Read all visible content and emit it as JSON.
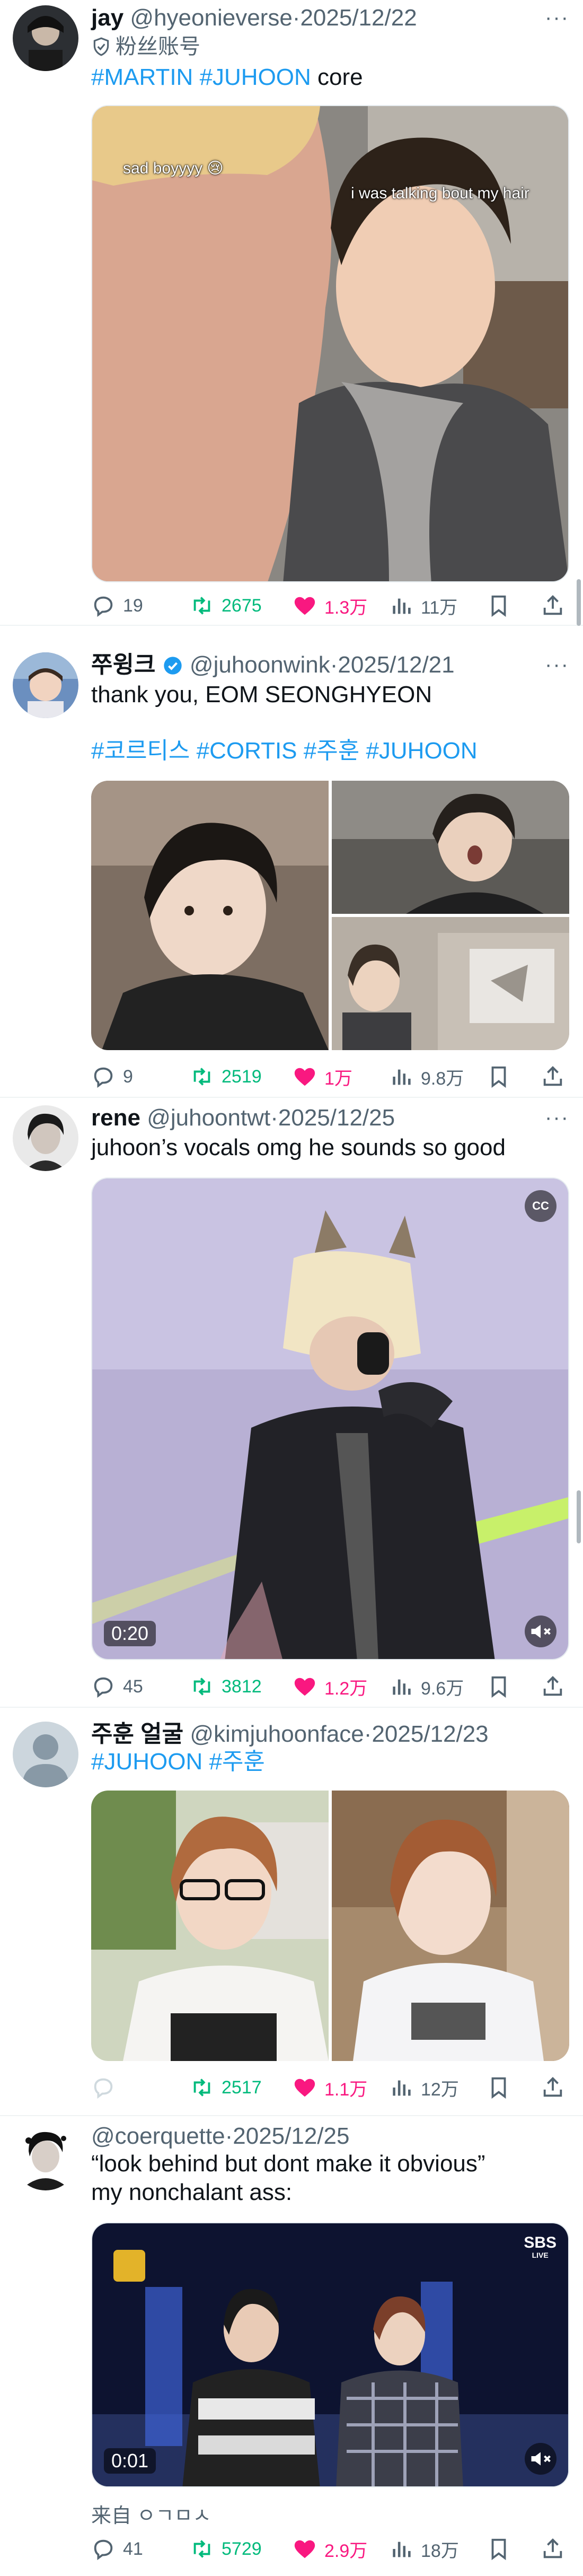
{
  "tweets": [
    {
      "name": "jay",
      "handle": "@hyeonieverse",
      "dot": "·",
      "date": "2025/12/22",
      "badge": "粉丝账号",
      "text_parts": [
        "#MARTIN",
        "#JUHOON",
        "core"
      ],
      "media_captions": [
        "sad boyyyy 😢",
        "i was talking bout my hair"
      ],
      "replies": "19",
      "retweets": "2675",
      "likes": "1.3万",
      "views": "11万"
    },
    {
      "name": "쭈윙크",
      "handle": "@juhoonwink",
      "dot": "·",
      "date": "2025/12/21",
      "text": "thank you, EOM SEONGHYEON",
      "tags": [
        "#코르티스",
        "#CORTIS",
        "#주훈",
        "#JUHOON"
      ],
      "replies": "9",
      "retweets": "2519",
      "likes": "1万",
      "views": "9.8万"
    },
    {
      "name": "rene",
      "handle": "@juhoontwt",
      "dot": "·",
      "date": "2025/12/25",
      "text": "juhoon’s vocals omg he sounds so good",
      "video_time": "0:20",
      "cc_label": "CC",
      "replies": "45",
      "retweets": "3812",
      "likes": "1.2万",
      "views": "9.6万"
    },
    {
      "name": "주훈 얼굴",
      "handle": "@kimjuhoonface",
      "dot": "·",
      "date": "2025/12/23",
      "tags": [
        "#JUHOON",
        "#주훈"
      ],
      "replies": "",
      "retweets": "2517",
      "likes": "1.1万",
      "views": "12万"
    },
    {
      "name": "",
      "handle": "@coerquette",
      "dot": "·",
      "date": "2025/12/25",
      "lines": [
        "“look behind but dont make it obvious”",
        "my nonchalant ass:"
      ],
      "video_time": "0:01",
      "broadcaster": "SBS",
      "broadcaster_sub": "LIVE",
      "from_label": "来自 ㅇㄱㅁㅅ",
      "replies": "41",
      "retweets": "5729",
      "likes": "2.9万",
      "views": "18万"
    }
  ],
  "more_icon": "···",
  "colors": {
    "link": "#1d9bf0",
    "retweet": "#00ba7c",
    "like": "#f91880",
    "muted": "#536471"
  }
}
